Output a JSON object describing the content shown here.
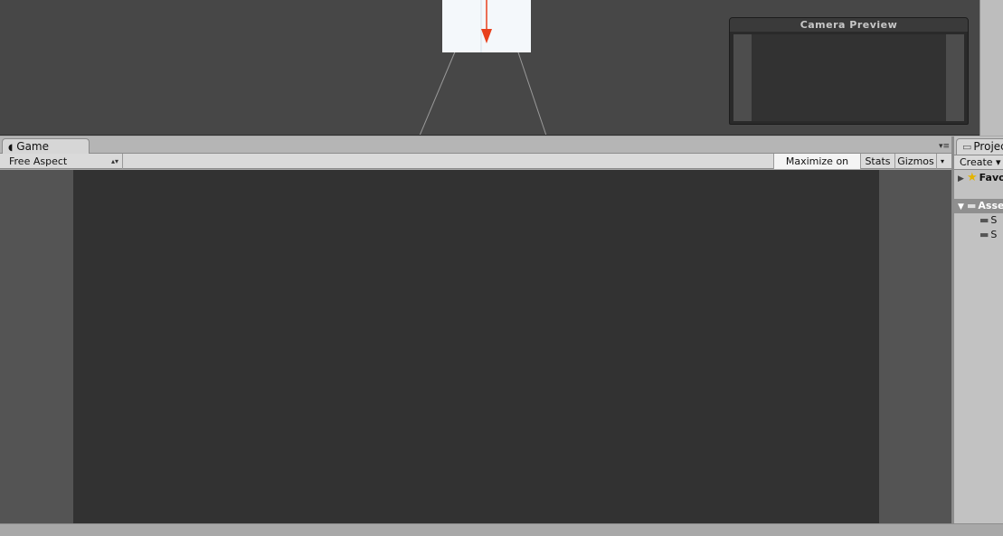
{
  "scene": {
    "camera_preview": {
      "title": "Camera Preview"
    }
  },
  "game_panel": {
    "tab_label": "Game",
    "tab_icon": "pacman-icon",
    "aspect": "Free Aspect",
    "toolbar": {
      "maximize_label": "Maximize on Play",
      "stats_label": "Stats",
      "gizmos_label": "Gizmos"
    }
  },
  "project_panel": {
    "tab_label": "Project",
    "create_label": "Create ▾",
    "tree": [
      {
        "label": "Favorites",
        "icon": "star-icon"
      },
      {
        "label": "Assets",
        "icon": "folder-icon"
      },
      {
        "label": "S",
        "icon": "folder-icon"
      },
      {
        "label": "S",
        "icon": "folder-icon"
      }
    ]
  },
  "colors": {
    "scene_bg": "#474747",
    "game_render_bg": "#323232",
    "camera_gizmo_arrow": "#e8401c",
    "favorites_star": "#e4b400"
  }
}
